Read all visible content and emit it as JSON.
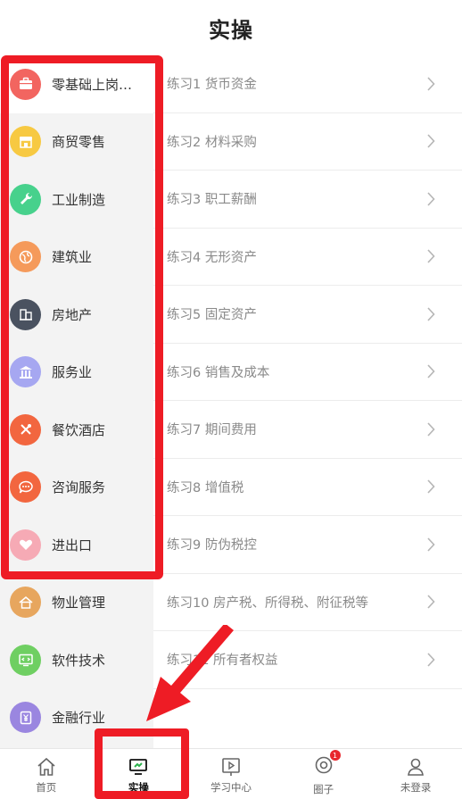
{
  "header": {
    "title": "实操"
  },
  "sidebar": {
    "items": [
      {
        "label": "零基础上岗专...",
        "icon": "briefcase-icon",
        "color": "#f26560",
        "active": true
      },
      {
        "label": "商贸零售",
        "icon": "shop-icon",
        "color": "#f7c942"
      },
      {
        "label": "工业制造",
        "icon": "wrench-icon",
        "color": "#47d18c"
      },
      {
        "label": "建筑业",
        "icon": "globe-icon",
        "color": "#f59a5b"
      },
      {
        "label": "房地产",
        "icon": "building-icon",
        "color": "#4a5260"
      },
      {
        "label": "服务业",
        "icon": "bank-icon",
        "color": "#a6a7f1"
      },
      {
        "label": "餐饮酒店",
        "icon": "cutlery-icon",
        "color": "#f2663f"
      },
      {
        "label": "咨询服务",
        "icon": "chat-icon",
        "color": "#f2663f"
      },
      {
        "label": "进出口",
        "icon": "handshake-icon",
        "color": "#f6aab5"
      },
      {
        "label": "物业管理",
        "icon": "house-icon",
        "color": "#e7a65e"
      },
      {
        "label": "软件技术",
        "icon": "code-icon",
        "color": "#6fcf62"
      },
      {
        "label": "金融行业",
        "icon": "yen-icon",
        "color": "#9a86e0"
      }
    ]
  },
  "lessons": [
    "练习1 货币资金",
    "练习2 材料采购",
    "练习3 职工薪酬",
    "练习4 无形资产",
    "练习5 固定资产",
    "练习6 销售及成本",
    "练习7 期间费用",
    "练习8 增值税",
    "练习9 防伪税控",
    "练习10 房产税、所得税、附征税等",
    "练习11 所有者权益"
  ],
  "tabbar": {
    "items": [
      {
        "label": "首页",
        "icon": "home-icon"
      },
      {
        "label": "实操",
        "icon": "practice-icon",
        "active": true
      },
      {
        "label": "学习中心",
        "icon": "play-icon"
      },
      {
        "label": "圈子",
        "icon": "circle-icon",
        "badge": "1"
      },
      {
        "label": "未登录",
        "icon": "user-icon"
      }
    ]
  }
}
